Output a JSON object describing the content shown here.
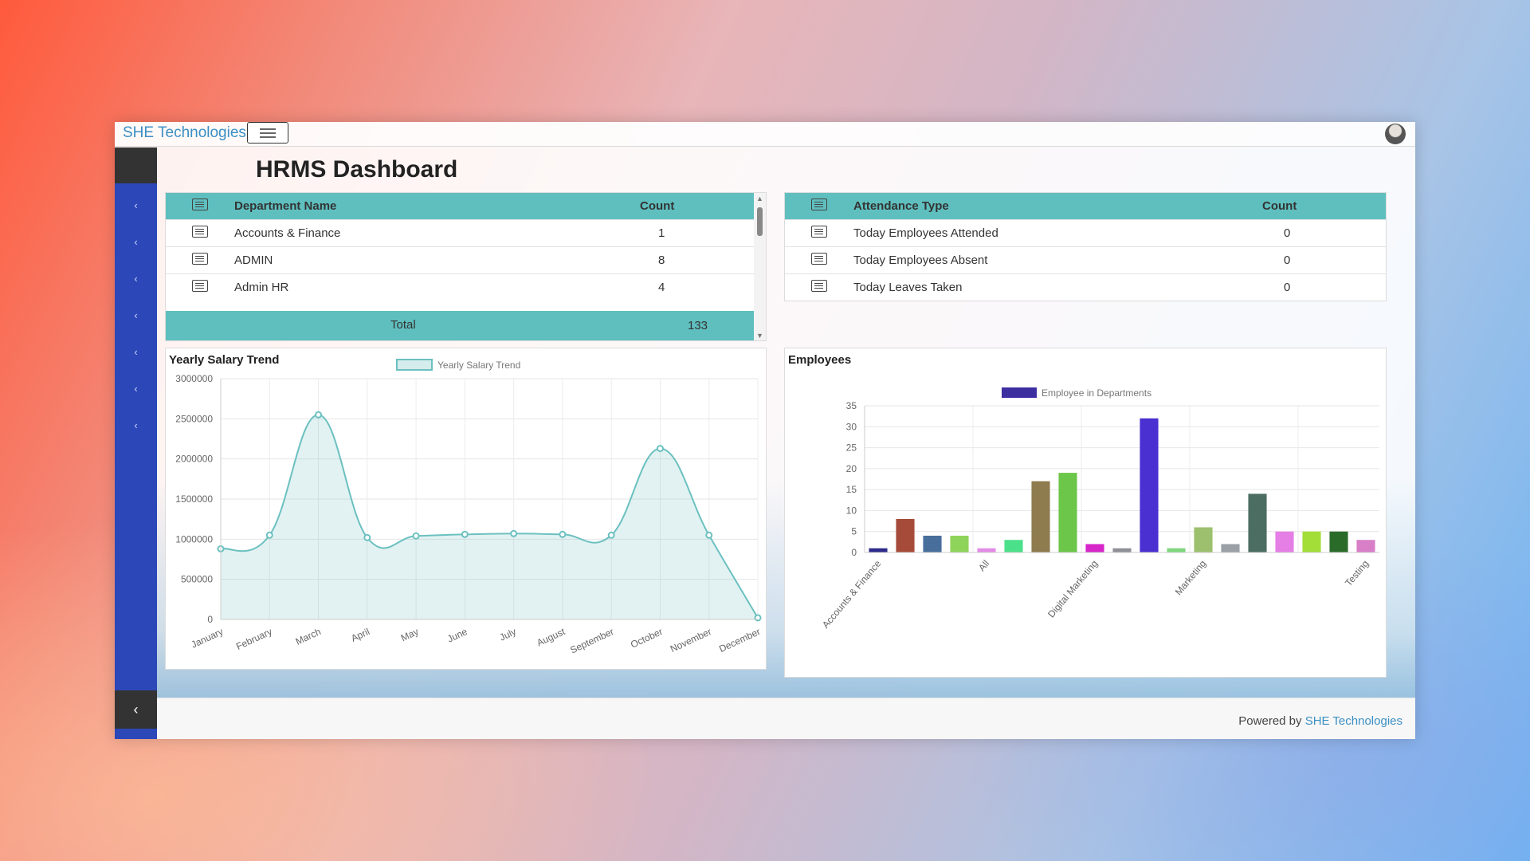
{
  "app": {
    "brand": "SHE Technologies",
    "page_title": "HRMS Dashboard"
  },
  "department_table": {
    "headers": [
      "Department Name",
      "Count"
    ],
    "rows": [
      {
        "name": "Accounts & Finance",
        "count": "1"
      },
      {
        "name": "ADMIN",
        "count": "8"
      },
      {
        "name": "Admin HR",
        "count": "4"
      }
    ],
    "total_label": "Total",
    "total_value": "133"
  },
  "attendance_table": {
    "headers": [
      "Attendance Type",
      "Count"
    ],
    "rows": [
      {
        "name": "Today Employees Attended",
        "count": "0"
      },
      {
        "name": "Today Employees Absent",
        "count": "0"
      },
      {
        "name": "Today Leaves Taken",
        "count": "0"
      }
    ]
  },
  "sidebar": {
    "items": [
      "‹",
      "‹",
      "‹",
      "‹",
      "‹",
      "‹",
      "‹"
    ],
    "collapse_icon": "‹"
  },
  "footer": {
    "prefix": "Powered by ",
    "link": "SHE Technologies"
  },
  "colors": {
    "teal": "#5fbfbf",
    "sidebar": "#2b47b8",
    "link": "#3a8fc4"
  },
  "chart_data": [
    {
      "type": "area",
      "title": "Yearly Salary Trend",
      "legend": "Yearly Salary Trend",
      "categories": [
        "January",
        "February",
        "March",
        "April",
        "May",
        "June",
        "July",
        "August",
        "September",
        "October",
        "November",
        "December"
      ],
      "values": [
        880000,
        1050000,
        2550000,
        1020000,
        1040000,
        1060000,
        1070000,
        1060000,
        1050000,
        2130000,
        1050000,
        20000
      ],
      "ylim": [
        0,
        3000000
      ],
      "yticks": [
        "0",
        "500000",
        "1000000",
        "1500000",
        "2000000",
        "2500000",
        "3000000"
      ],
      "color": "#6cc0c0"
    },
    {
      "type": "bar",
      "title": "Employees",
      "legend": "Employee in Departments",
      "categories": [
        "Accounts & Finance",
        "",
        "",
        "",
        "All",
        "",
        "",
        "",
        "Digital Marketing",
        "",
        "",
        "",
        "Marketing",
        "",
        "",
        "",
        "",
        "",
        "Testing"
      ],
      "values": [
        1,
        8,
        4,
        4,
        1,
        3,
        17,
        19,
        2,
        1,
        32,
        1,
        6,
        2,
        14,
        5,
        5,
        5,
        3
      ],
      "colors": [
        "#2d2a8a",
        "#a64b3a",
        "#486e9c",
        "#8fd45a",
        "#e38be6",
        "#4be08a",
        "#8e7b4e",
        "#6cc64a",
        "#d625c8",
        "#8f8f98",
        "#4a2fd1",
        "#7ed77e",
        "#9cc06e",
        "#9aa0a6",
        "#4c6e62",
        "#e57fe6",
        "#a3de38",
        "#2b6b2a",
        "#d87fc8"
      ],
      "ylim": [
        0,
        35
      ],
      "yticks": [
        "0",
        "5",
        "10",
        "15",
        "20",
        "25",
        "30",
        "35"
      ]
    }
  ]
}
